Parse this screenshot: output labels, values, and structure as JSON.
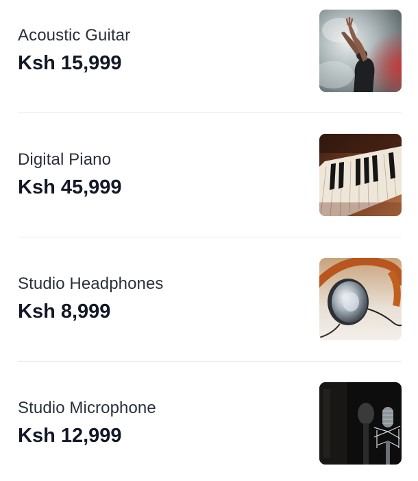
{
  "products": [
    {
      "name": "Acoustic Guitar",
      "price": "Ksh 15,999",
      "image_icon": "concert-performer-image"
    },
    {
      "name": "Digital Piano",
      "price": "Ksh 45,999",
      "image_icon": "piano-keys-image"
    },
    {
      "name": "Studio Headphones",
      "price": "Ksh 8,999",
      "image_icon": "headphones-image"
    },
    {
      "name": "Studio Microphone",
      "price": "Ksh 12,999",
      "image_icon": "microphone-image"
    }
  ],
  "colors": {
    "name_text": "#2a303b",
    "price_text": "#121826",
    "divider": "#e6e8eb"
  }
}
